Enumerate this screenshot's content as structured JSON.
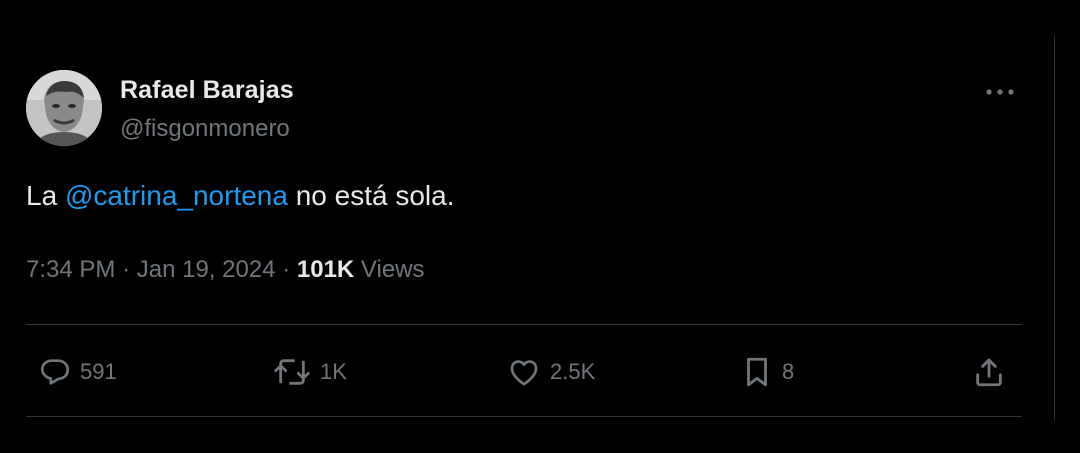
{
  "author": {
    "name": "Rafael Barajas",
    "handle": "@fisgonmonero",
    "avatar_icon": "profile-photo"
  },
  "tweet": {
    "text_before": "La ",
    "mention": "@catrina_nortena",
    "text_after": " no está sola."
  },
  "meta": {
    "time": "7:34 PM",
    "separator": "·",
    "date": "Jan 19, 2024",
    "views_count": "101K",
    "views_label": "Views"
  },
  "actions": {
    "replies": "591",
    "retweets": "1K",
    "likes": "2.5K",
    "bookmarks": "8"
  },
  "colors": {
    "background": "#000000",
    "text": "#e7e9ea",
    "secondary": "#71767b",
    "accent": "#1d9bf0",
    "divider": "#2f3336"
  }
}
